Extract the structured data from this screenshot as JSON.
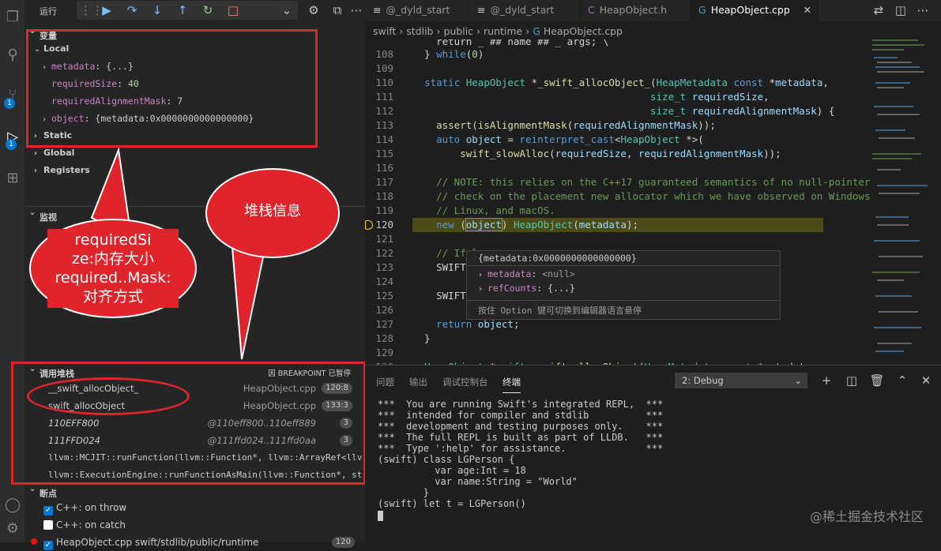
{
  "debug_toolbar": {
    "run_label": "运行",
    "buttons": [
      "grip",
      "continue",
      "step-over",
      "step-into",
      "step-out",
      "restart",
      "stop"
    ]
  },
  "variables": {
    "section_title": "变量",
    "local_label": "Local",
    "items": [
      {
        "name": "metadata",
        "value": "{...}",
        "expandable": true
      },
      {
        "name": "requiredSize",
        "value": "40",
        "expandable": false
      },
      {
        "name": "requiredAlignmentMask",
        "value": "7",
        "expandable": false
      },
      {
        "name": "object",
        "value": "{metadata:0x0000000000000000}",
        "expandable": true
      }
    ],
    "static_label": "Static",
    "global_label": "Global",
    "registers_label": "Registers"
  },
  "watch": {
    "title": "监视"
  },
  "callstack": {
    "title": "调用堆栈",
    "status": "因 BREAKPOINT 已暂停",
    "frames": [
      {
        "fn": "__swift_allocObject_",
        "file": "HeapObject.cpp",
        "badge": "120:8",
        "italic": false
      },
      {
        "fn": "swift_allocObject",
        "file": "HeapObject.cpp",
        "badge": "133:3",
        "italic": false
      },
      {
        "fn": "110EFF800",
        "file": "@110eff800..110eff889",
        "badge": "3",
        "italic": true
      },
      {
        "fn": "111FFD024",
        "file": "@111ffd024..111ffd0aa",
        "badge": "3",
        "italic": true
      },
      {
        "fn": "llvm::MCJIT::runFunction(llvm::Function*, llvm::ArrayRef<llv",
        "file": "",
        "badge": "",
        "italic": false
      },
      {
        "fn": "llvm::ExecutionEngine::runFunctionAsMain(llvm::Function*, st",
        "file": "",
        "badge": "",
        "italic": false
      }
    ]
  },
  "breakpoints": {
    "title": "断点",
    "items": [
      {
        "label": "C++: on throw",
        "checked": true
      },
      {
        "label": "C++: on catch",
        "checked": false
      },
      {
        "label": "HeapObject.cpp  swift/stdlib/public/runtime",
        "checked": true,
        "badge": "120"
      }
    ]
  },
  "annotations": {
    "bubble1": [
      "requiredSi",
      "ze:内存大小",
      "required..Mask:",
      "对齐方式"
    ],
    "bubble2": "堆栈信息",
    "color": "#e0242b"
  },
  "tabs": [
    {
      "label": "@_dyld_start",
      "icon": "list-icon"
    },
    {
      "label": "@_dyld_start",
      "icon": "list-icon"
    },
    {
      "label": "HeapObject.h",
      "icon": "c-icon"
    },
    {
      "label": "HeapObject.cpp",
      "icon": "cpp-icon",
      "active": true
    }
  ],
  "breadcrumb": [
    "swift",
    "stdlib",
    "public",
    "runtime",
    "HeapObject.cpp"
  ],
  "code": {
    "current_line": "120",
    "lines": [
      {
        "n": "",
        "t": "    return _ ## name ## _ args; \\"
      },
      {
        "n": "108",
        "t": "  } while(0)"
      },
      {
        "n": "109",
        "t": ""
      },
      {
        "n": "110",
        "t": "  static HeapObject *_swift_allocObject_(HeapMetadata const *metadata,"
      },
      {
        "n": "111",
        "t": "                                        size_t requiredSize,"
      },
      {
        "n": "112",
        "t": "                                        size_t requiredAlignmentMask) {"
      },
      {
        "n": "113",
        "t": "    assert(isAlignmentMask(requiredAlignmentMask));"
      },
      {
        "n": "114",
        "t": "    auto object = reinterpret_cast<HeapObject *>("
      },
      {
        "n": "115",
        "t": "        swift_slowAlloc(requiredSize, requiredAlignmentMask));"
      },
      {
        "n": "116",
        "t": ""
      },
      {
        "n": "117",
        "t": "    // NOTE: this relies on the C++17 guaranteed semantics of no null-pointer"
      },
      {
        "n": "118",
        "t": "    // check on the placement new allocator which we have observed on Windows,"
      },
      {
        "n": "119",
        "t": "    // Linux, and macOS."
      },
      {
        "n": "120",
        "t": "    new (object) HeapObject(metadata);"
      },
      {
        "n": "121",
        "t": ""
      },
      {
        "n": "122",
        "t": "    // If l"
      },
      {
        "n": "123",
        "t": "    SWIFT_L"
      },
      {
        "n": "124",
        "t": ""
      },
      {
        "n": "125",
        "t": "    SWIFT_R"
      },
      {
        "n": "126",
        "t": ""
      },
      {
        "n": "127",
        "t": "    return object;"
      },
      {
        "n": "128",
        "t": "  }"
      },
      {
        "n": "129",
        "t": ""
      },
      {
        "n": "130",
        "t": "  HeapObject *swift::swift_allocObject(HeapMetadata const *metadata,"
      }
    ]
  },
  "hover": {
    "title": "{metadata:0x0000000000000000}",
    "rows": [
      {
        "name": "metadata",
        "value": "<null>"
      },
      {
        "name": "refCounts",
        "value": "{...}"
      }
    ],
    "hint": "按住 Option 键可切换到编辑器语言悬停"
  },
  "panel": {
    "tabs": [
      "问题",
      "输出",
      "调试控制台",
      "终端"
    ],
    "active_tab": "终端",
    "terminal_select": "2: Debug",
    "lines": [
      "***  You are running Swift's integrated REPL,  ***",
      "***  intended for compiler and stdlib          ***",
      "***  development and testing purposes only.    ***",
      "***  The full REPL is built as part of LLDB.   ***",
      "***  Type ':help' for assistance.              ***",
      "(swift) class LGPerson {",
      "          var age:Int = 18",
      "          var name:String = \"World\"",
      "        }",
      "(swift) let t = LGPerson()"
    ]
  },
  "watermark": "@稀土掘金技术社区"
}
